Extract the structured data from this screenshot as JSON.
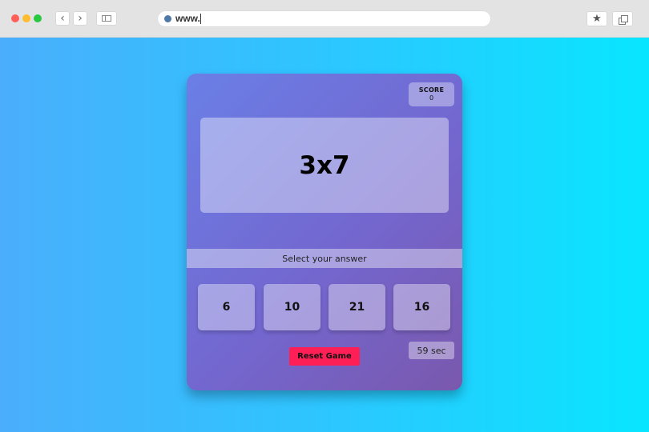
{
  "browser": {
    "url_text": "www.",
    "back_glyph": "‹",
    "forward_glyph": "›",
    "star_glyph": "★",
    "icons": {
      "back": "chevron-left-icon",
      "forward": "chevron-right-icon",
      "sidebar": "sidebar-icon",
      "site": "globe-dot-icon",
      "bookmark": "star-icon",
      "tabs": "tabs-icon"
    }
  },
  "game": {
    "score": {
      "label": "SCORE",
      "value": "0"
    },
    "question": "3x7",
    "instruction": "Select your answer",
    "choices": [
      "6",
      "10",
      "21",
      "16"
    ],
    "timer": "59 sec",
    "reset_label": "Reset Game"
  },
  "colors": {
    "background_gradient": [
      "#4aaefc",
      "#08e6ff"
    ],
    "card_gradient": [
      "#6a7fe6",
      "#7a58ad"
    ],
    "reset_button": "#ff1f57"
  }
}
